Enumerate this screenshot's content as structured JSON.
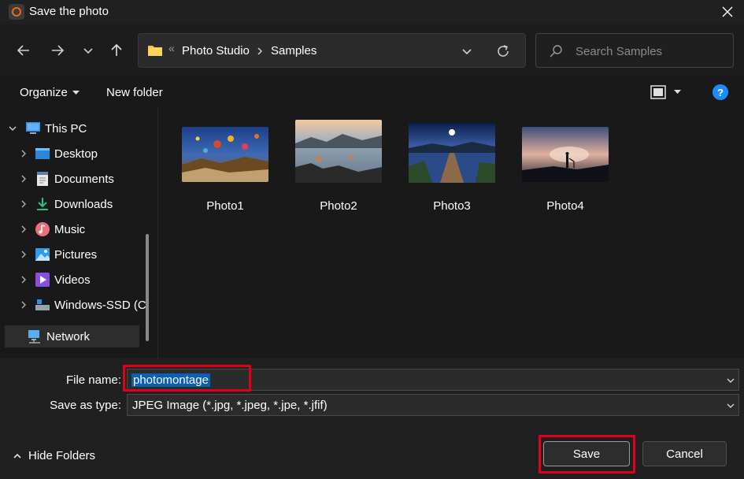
{
  "window": {
    "title": "Save the photo"
  },
  "nav": {
    "breadcrumb_sep": "«",
    "path": [
      "Photo Studio",
      "Samples"
    ],
    "search_placeholder": "Search Samples"
  },
  "commands": {
    "organize": "Organize",
    "new_folder": "New folder"
  },
  "tree": {
    "root": "This PC",
    "items": [
      "Desktop",
      "Documents",
      "Downloads",
      "Music",
      "Pictures",
      "Videos",
      "Windows-SSD (C"
    ],
    "network": "Network"
  },
  "files": [
    "Photo1",
    "Photo2",
    "Photo3",
    "Photo4"
  ],
  "form": {
    "file_name_label": "File name:",
    "file_name_value": "photomontage",
    "type_label": "Save as type:",
    "type_value": "JPEG Image (*.jpg, *.jpeg, *.jpe, *.jfif)"
  },
  "footer": {
    "hide_folders": "Hide Folders",
    "save": "Save",
    "cancel": "Cancel"
  },
  "colors": {
    "accent": "#0a5fb4",
    "highlight": "#e0001b",
    "folder": "#f5c443"
  }
}
